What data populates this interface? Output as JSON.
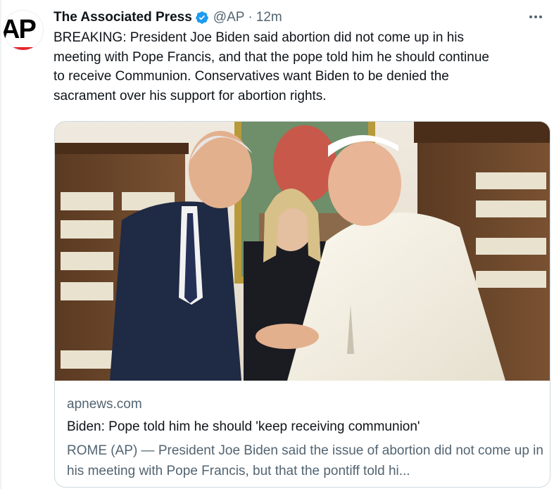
{
  "author": {
    "display_name": "The Associated Press",
    "handle": "@AP",
    "separator": "·",
    "time": "12m",
    "avatar_text": "AP",
    "verified": true
  },
  "tweet": {
    "text": "BREAKING: President Joe Biden said abortion did not come up in his\nmeeting with Pope Francis, and that the pope told him he should continue\nto receive Communion. Conservatives want Biden to be denied the\nsacrament over his support for abortion rights."
  },
  "card": {
    "domain": "apnews.com",
    "title": "Biden: Pope told him he should 'keep receiving communion'",
    "description": "ROME (AP) — President Joe Biden said the issue of abortion did not come up in his meeting with Pope Francis, but that the pontiff told hi..."
  },
  "icons": {
    "verified": "verified-badge-icon",
    "more": "more-options-icon"
  },
  "colors": {
    "text_primary": "#0f1419",
    "text_secondary": "#536471",
    "verified_blue": "#1d9bf0",
    "border": "#cfd9de",
    "ap_red": "#e4262f"
  }
}
